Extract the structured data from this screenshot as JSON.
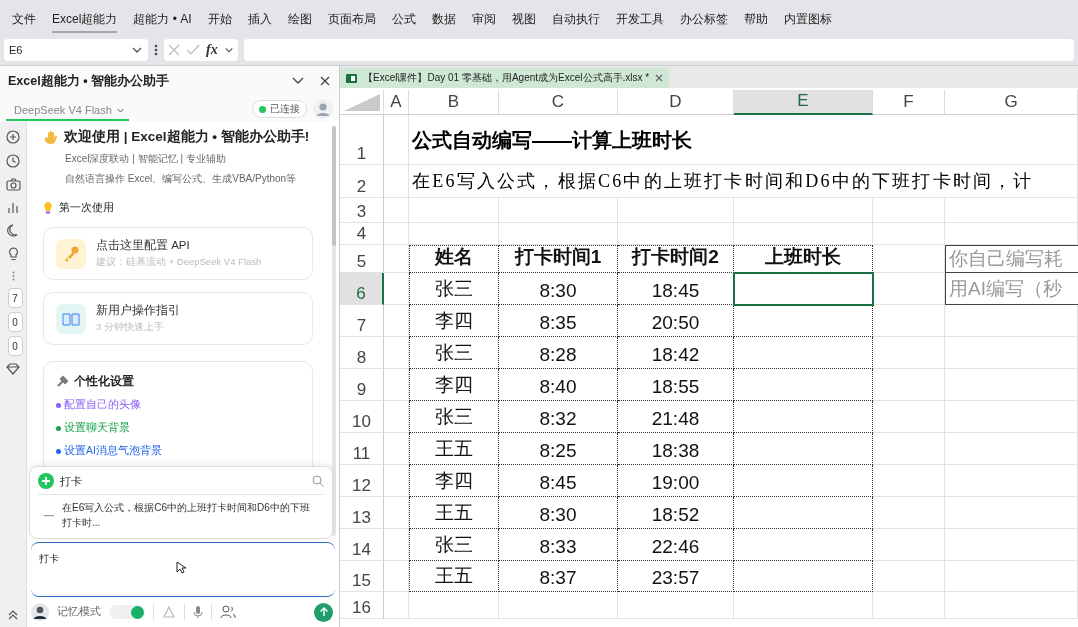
{
  "menu": [
    {
      "label": "文件",
      "selected": false
    },
    {
      "label": "Excel超能力",
      "selected": true
    },
    {
      "label": "超能力 • AI",
      "selected": false
    },
    {
      "label": "开始",
      "selected": false
    },
    {
      "label": "插入",
      "selected": false
    },
    {
      "label": "绘图",
      "selected": false
    },
    {
      "label": "页面布局",
      "selected": false
    },
    {
      "label": "公式",
      "selected": false
    },
    {
      "label": "数据",
      "selected": false
    },
    {
      "label": "审阅",
      "selected": false
    },
    {
      "label": "视图",
      "selected": false
    },
    {
      "label": "自动执行",
      "selected": false
    },
    {
      "label": "开发工具",
      "selected": false
    },
    {
      "label": "办公标签",
      "selected": false
    },
    {
      "label": "帮助",
      "selected": false
    },
    {
      "label": "内置图标",
      "selected": false
    }
  ],
  "formula_bar": {
    "name_box": "E6",
    "function_label": "fx"
  },
  "assistant": {
    "title": "Excel超能力 • 智能办公助手",
    "model": "DeepSeek V4 Flash",
    "status": "已连接",
    "rail_badges": [
      "7",
      "0",
      "0"
    ],
    "welcome": {
      "title": "欢迎使用 | Excel超能力 • 智能办公助手!",
      "lines": [
        "Excel深度联动 | 智能记忆 | 专业辅助",
        "自然语言操作 Excel、编写公式、生成VBA/Python等"
      ]
    },
    "first_use": {
      "heading": "第一次使用",
      "cards": [
        {
          "kind": "key",
          "title": "点击这里配置 API",
          "subtitle": "建议：硅基流动 + DeepSeek V4 Flash"
        },
        {
          "kind": "book",
          "title": "新用户操作指引",
          "subtitle": "3 分钟快速上手"
        }
      ]
    },
    "personalize": {
      "heading": "个性化设置",
      "links": [
        {
          "label": "配置自己的头像",
          "color": "#8b5cf6"
        },
        {
          "label": "设置聊天背景",
          "color": "#16a34a"
        },
        {
          "label": "设置AI消息气泡背景",
          "color": "#2563eb"
        }
      ]
    },
    "suggest": {
      "query": "打卡",
      "items": [
        "在E6写入公式，根据C6中的上班打卡时间和D6中的下班打卡时..."
      ]
    },
    "input": {
      "value": "打卡"
    },
    "memory_mode": {
      "label": "记忆模式",
      "on": true
    }
  },
  "sheet": {
    "tab": {
      "title": "【Excel课件】Day 01 零基础，用Agent成为Excel公式高手.xlsx *"
    },
    "columns": [
      {
        "label": "A",
        "selected": false
      },
      {
        "label": "B",
        "selected": false
      },
      {
        "label": "C",
        "selected": false
      },
      {
        "label": "D",
        "selected": false
      },
      {
        "label": "E",
        "selected": true
      },
      {
        "label": "F",
        "selected": false
      },
      {
        "label": "G",
        "selected": false
      }
    ],
    "rows": [
      {
        "label": "1",
        "selected": false,
        "kind": "title",
        "text": "公式自动编写——计算上班时长"
      },
      {
        "label": "2",
        "selected": false,
        "kind": "note",
        "text": "在E6写入公式，根据C6中的上班打卡时间和D6中的下班打卡时间，计"
      },
      {
        "label": "3",
        "selected": false,
        "kind": "blank"
      },
      {
        "label": "4",
        "selected": false,
        "kind": "blank"
      },
      {
        "label": "5",
        "selected": false,
        "kind": "header",
        "cells": [
          "姓名",
          "打卡时间1",
          "打卡时间2",
          "上班时长"
        ],
        "side": "你自己编写耗"
      },
      {
        "label": "6",
        "selected": true,
        "kind": "data",
        "cells": [
          "张三",
          "8:30",
          "18:45"
        ],
        "side": "用AI编写（秒"
      },
      {
        "label": "7",
        "selected": false,
        "kind": "data",
        "cells": [
          "李四",
          "8:35",
          "20:50"
        ]
      },
      {
        "label": "8",
        "selected": false,
        "kind": "data",
        "cells": [
          "张三",
          "8:28",
          "18:42"
        ]
      },
      {
        "label": "9",
        "selected": false,
        "kind": "data",
        "cells": [
          "李四",
          "8:40",
          "18:55"
        ]
      },
      {
        "label": "10",
        "selected": false,
        "kind": "data",
        "cells": [
          "张三",
          "8:32",
          "21:48"
        ]
      },
      {
        "label": "11",
        "selected": false,
        "kind": "data",
        "cells": [
          "王五",
          "8:25",
          "18:38"
        ]
      },
      {
        "label": "12",
        "selected": false,
        "kind": "data",
        "cells": [
          "李四",
          "8:45",
          "19:00"
        ]
      },
      {
        "label": "13",
        "selected": false,
        "kind": "data",
        "cells": [
          "王五",
          "8:30",
          "18:52"
        ]
      },
      {
        "label": "14",
        "selected": false,
        "kind": "data",
        "cells": [
          "张三",
          "8:33",
          "22:46"
        ]
      },
      {
        "label": "15",
        "selected": false,
        "kind": "data",
        "cells": [
          "王五",
          "8:37",
          "23:57"
        ]
      },
      {
        "label": "16",
        "selected": false,
        "kind": "blank"
      }
    ]
  }
}
